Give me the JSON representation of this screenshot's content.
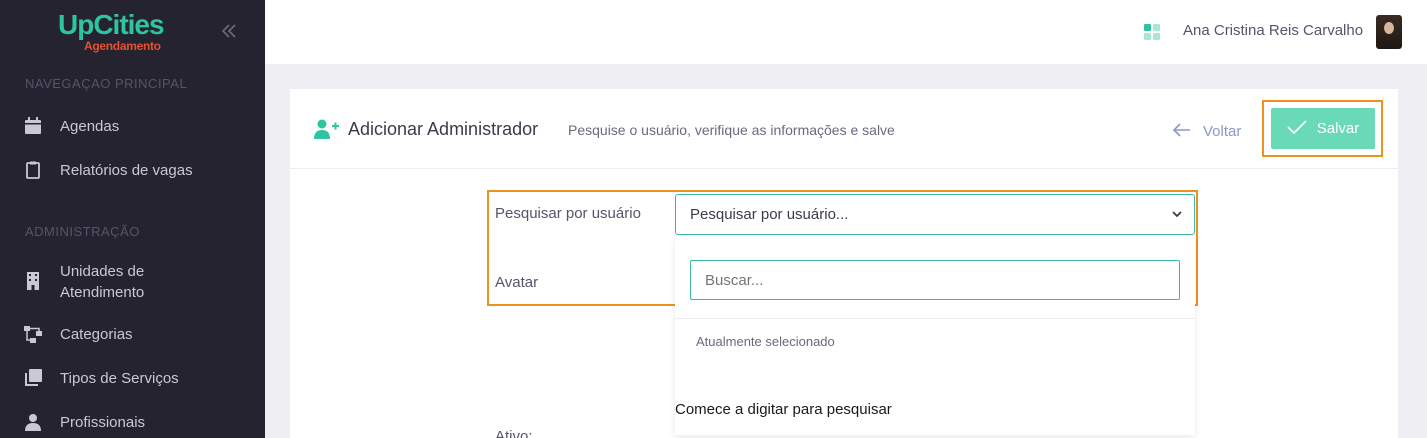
{
  "brand": {
    "name": "UpCities",
    "sub": "Agendamento"
  },
  "sidebar": {
    "section_main": "NAVEGAÇAO PRINCIPAL",
    "section_admin": "ADMINISTRAÇÃO",
    "items": [
      {
        "label": "Agendas",
        "icon": "calendar-icon"
      },
      {
        "label": "Relatórios de vagas",
        "icon": "clipboard-icon"
      },
      {
        "label": "Unidades de Atendimento",
        "icon": "building-icon"
      },
      {
        "label": "Categorias",
        "icon": "sitemap-icon"
      },
      {
        "label": "Tipos de Serviços",
        "icon": "layers-icon"
      },
      {
        "label": "Profissionais",
        "icon": "user-tie-icon"
      }
    ],
    "unidades_line1": "Unidades de",
    "unidades_line2": "Atendimento"
  },
  "topbar": {
    "user_name": "Ana Cristina Reis Carvalho"
  },
  "page": {
    "title": "Adicionar Administrador",
    "subtitle": "Pesquise o usuário, verifique as informações e salve",
    "back_label": "Voltar",
    "save_label": "Salvar"
  },
  "form": {
    "user_label": "Pesquisar por usuário",
    "user_select_value": "Pesquisar por usuário...",
    "avatar_label": "Avatar",
    "active_label": "Ativo:"
  },
  "dropdown": {
    "search_placeholder": "Buscar...",
    "current_label": "Atualmente selecionado",
    "hint": "Comece a digitar para pesquisar"
  },
  "colors": {
    "accent": "#2ec4a0",
    "highlight": "#f0901e",
    "sidebar_bg": "#25232f",
    "save_bg": "#6ad9b5"
  }
}
